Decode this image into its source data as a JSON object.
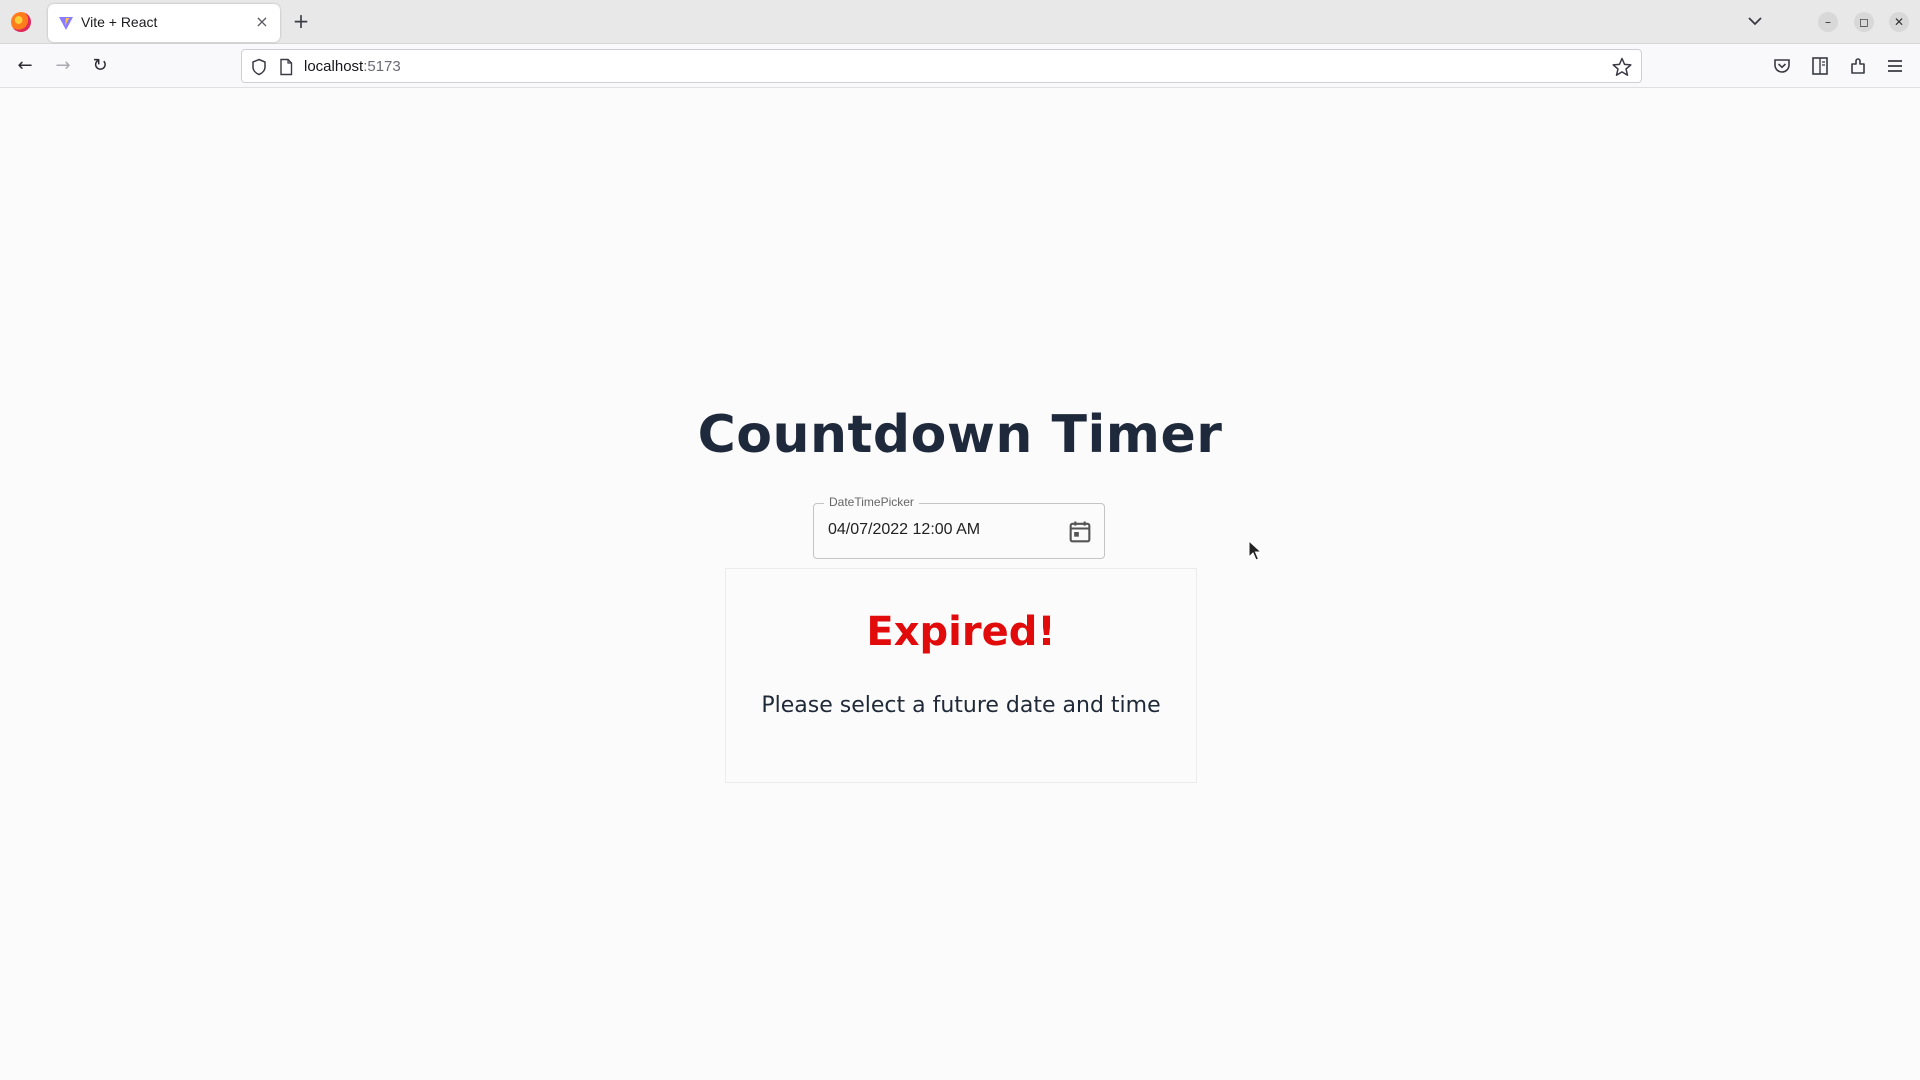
{
  "browser": {
    "tab": {
      "title": "Vite + React",
      "favicon": "vite-icon",
      "close_glyph": "×"
    },
    "new_tab_glyph": "+",
    "nav": {
      "back_glyph": "←",
      "forward_glyph": "→",
      "reload_glyph": "↻"
    },
    "url": {
      "host": "localhost",
      "port": ":5173"
    },
    "window_controls": {
      "minimize": "–",
      "maximize": "◻",
      "close": "✕"
    }
  },
  "page": {
    "title": "Countdown Timer",
    "datetime_picker": {
      "label": "DateTimePicker",
      "value": "04/07/2022 12:00 AM",
      "icon": "calendar-icon"
    },
    "status": {
      "heading": "Expired!",
      "message": "Please select a future date and time",
      "color": "#e10b0b"
    }
  }
}
